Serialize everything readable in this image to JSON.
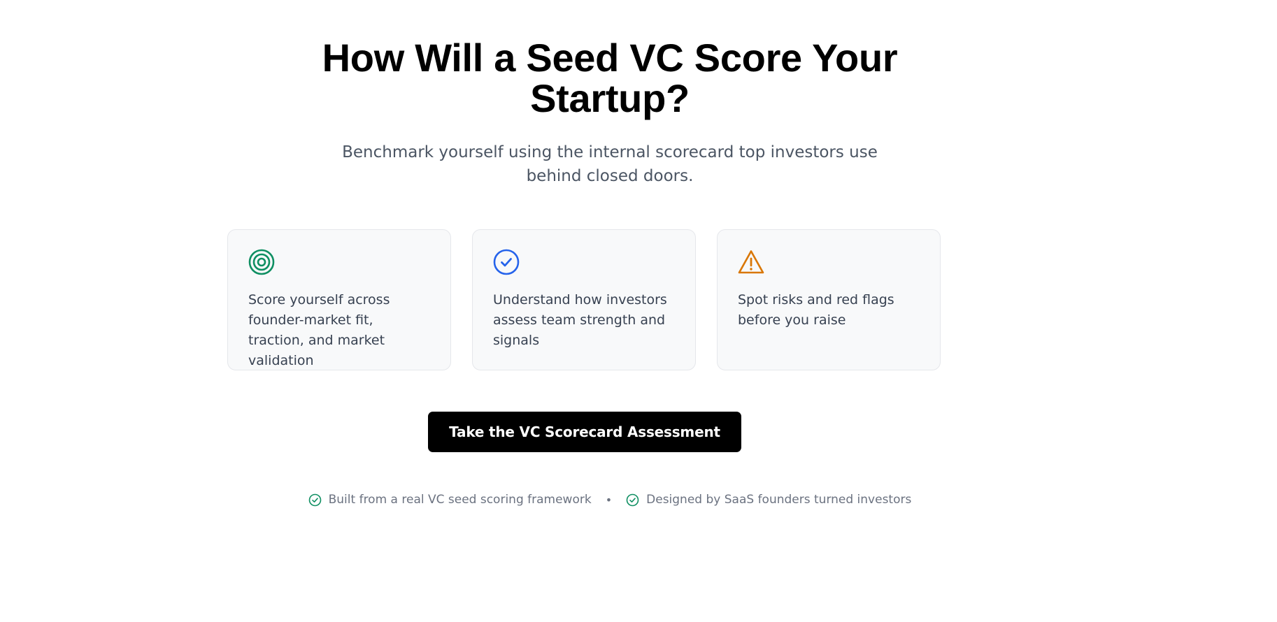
{
  "hero": {
    "headline_line1": "How Will a Seed VC Score Your",
    "headline_line2": "Startup?",
    "subhead_line1": "Benchmark yourself using the internal scorecard top investors use",
    "subhead_line2": "behind closed doors."
  },
  "features": [
    {
      "icon": "target-icon",
      "icon_color": "#0f8f62",
      "text": "Score yourself across founder-market fit, traction, and market validation"
    },
    {
      "icon": "check-circle-icon",
      "icon_color": "#2563eb",
      "text": "Understand how investors assess team strength and signals"
    },
    {
      "icon": "warning-triangle-icon",
      "icon_color": "#d97706",
      "text": "Spot risks and red flags before you raise"
    }
  ],
  "cta": {
    "label": "Take the VC Scorecard Assessment",
    "background": "#000000",
    "text_color": "#ffffff"
  },
  "trust": {
    "check_color": "#0f8f62",
    "separator": "•",
    "items": [
      "Built from a real VC seed scoring framework",
      "Designed by SaaS founders turned investors"
    ]
  }
}
